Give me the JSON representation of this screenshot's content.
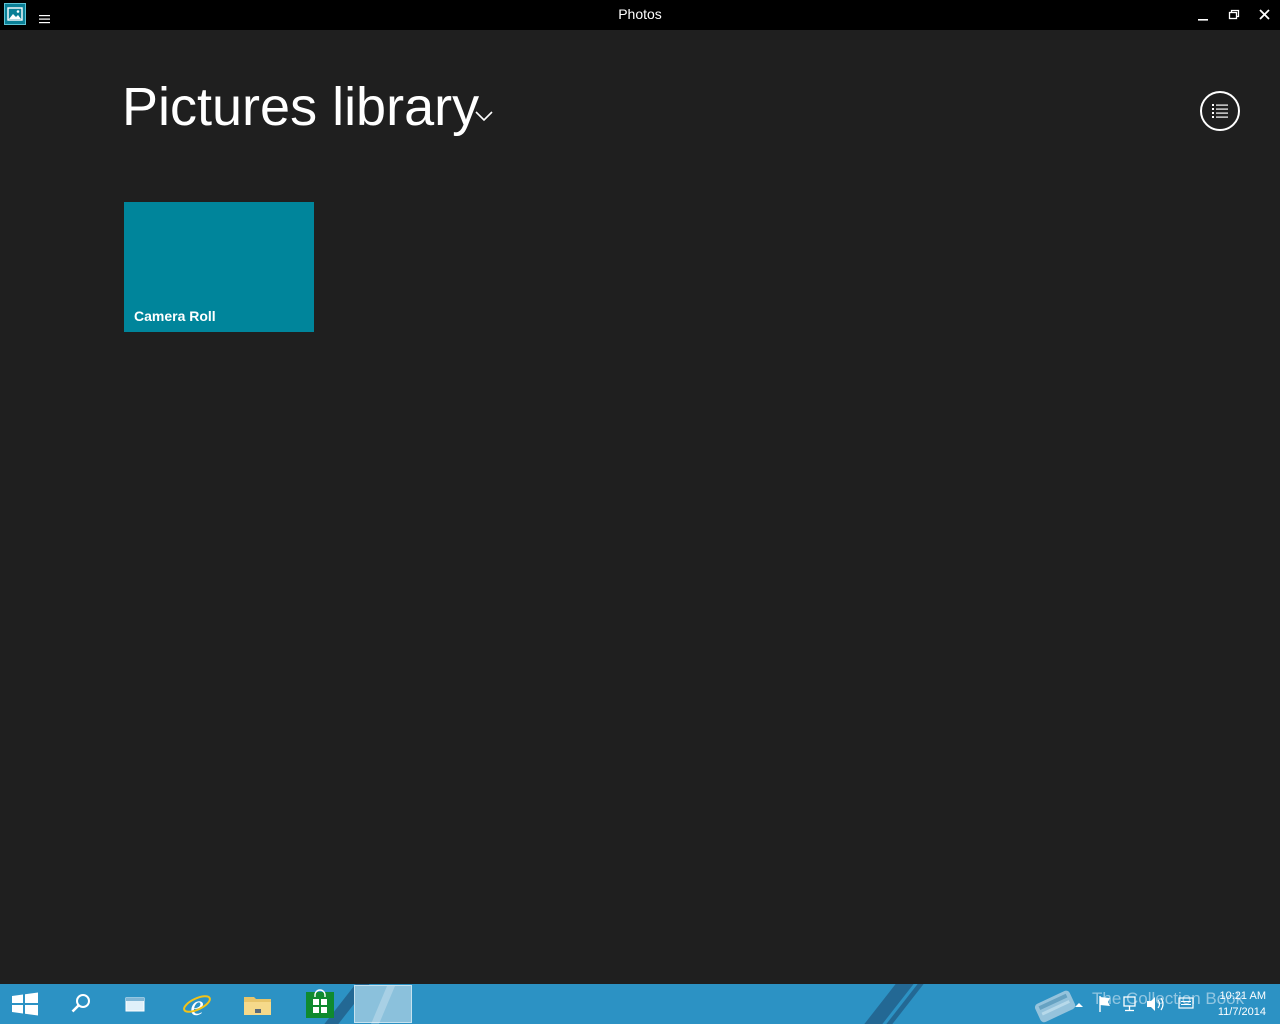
{
  "window": {
    "title": "Photos",
    "app_icon": "photos-icon",
    "menu_icon": "hamburger-icon",
    "controls": [
      "minimize-icon",
      "restore-icon",
      "close-icon"
    ]
  },
  "main": {
    "title": "Pictures library",
    "title_dropdown_icon": "chevron-down-icon",
    "view_toggle_icon": "list-view-icon",
    "tiles": [
      {
        "label": "Camera Roll",
        "color": "#00859b"
      }
    ]
  },
  "taskbar": {
    "items": [
      "windows-start-icon",
      "search-icon",
      "task-view-icon",
      "internet-explorer-icon",
      "file-explorer-icon",
      "store-icon",
      "photos-app-button"
    ],
    "tray_icons": [
      "show-hidden-icons-icon",
      "action-center-flag-icon",
      "network-icon",
      "volume-icon",
      "keyboard-icon"
    ],
    "time": "10:21 AM",
    "date": "11/7/2014",
    "watermark": "The Collection Book",
    "accent": "#2c92c4"
  }
}
